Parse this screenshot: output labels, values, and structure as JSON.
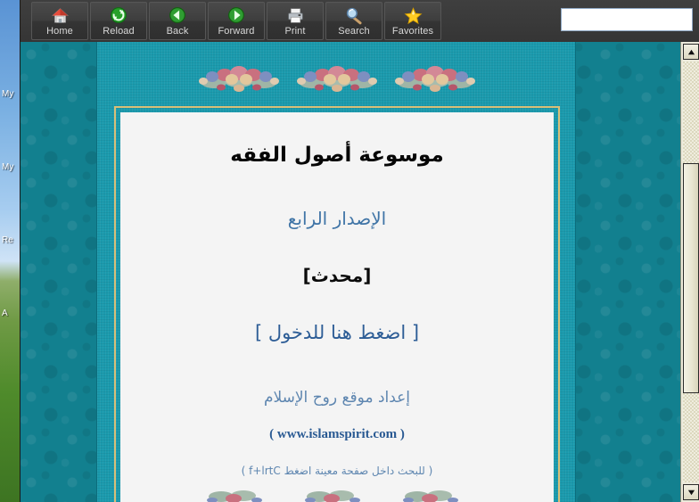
{
  "window": {
    "app_background_color": "#3a3a3a"
  },
  "desktop": {
    "icon_labels": [
      "My",
      "My",
      "Re",
      "A"
    ]
  },
  "toolbar": {
    "buttons": [
      {
        "label": "Home",
        "icon": "home-icon"
      },
      {
        "label": "Reload",
        "icon": "reload-icon"
      },
      {
        "label": "Back",
        "icon": "back-arrow-icon"
      },
      {
        "label": "Forward",
        "icon": "forward-arrow-icon"
      },
      {
        "label": "Print",
        "icon": "printer-icon"
      },
      {
        "label": "Search",
        "icon": "magnifier-icon"
      },
      {
        "label": "Favorites",
        "icon": "star-icon"
      }
    ],
    "search": {
      "value": "",
      "placeholder": "",
      "go_icon": "magnifier-icon"
    }
  },
  "content": {
    "title_main": "موسوعة أصول الفقه",
    "subtitle_edition": "الإصدار الرابع",
    "badge_updated": "[محدث]",
    "enter_link": "[ اضغط هنا للدخول ]",
    "prepared_by": "إعداد موقع روح الإسلام",
    "site_url": "( www.islamspirit.com )",
    "search_hint": "( للبحث داخل صفحة معينة اضغط Ctrl+f )",
    "ornament_top": "floral-garland",
    "ornament_bottom": "floral-garland"
  },
  "colors": {
    "page_teal": "#1a9aad",
    "damask_teal": "#12808f",
    "gold_border": "#d8bf78",
    "sheet": "#f4f4f4",
    "title_black": "#060606",
    "accent_blue": "#3f74a6",
    "link_blue": "#2d5d96",
    "muted_blue": "#5e86b0",
    "toolbar_dark": "#3a3a3a",
    "scrollbar_cream": "#eceadb"
  },
  "scrollbar": {
    "up_arrow": "triangle-up-icon",
    "down_arrow": "triangle-down-icon",
    "thumb_position_percent": 24
  }
}
